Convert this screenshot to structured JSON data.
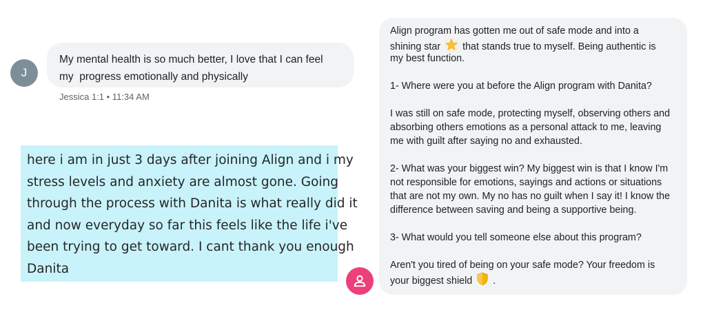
{
  "jessica": {
    "avatar_initial": "J",
    "message_lines": [
      "My mental health is so much better, I love that I can feel",
      "my  progress emotionally and physically"
    ],
    "meta": "Jessica 1:1 • 11:34 AM"
  },
  "note": {
    "lines": [
      "here i am in just 3 days after joining Align and i my",
      "stress levels and anxiety are almost gone. Going",
      "through the process with Danita is what really did it",
      "and now everyday  so far this feels like the life i've",
      "been trying to get toward. I cant thank you enough",
      "Danita"
    ]
  },
  "align_message": {
    "line1": "Align program has gotten me out of safe mode and into a",
    "line2_before": "shining star",
    "line2_after": "that stands true to myself. Being authentic is",
    "line3": "my best function.",
    "q1": "1- Where were you at before the Align program with Danita?",
    "a1_lines": [
      "I was still on safe mode, protecting myself, observing others and",
      "absorbing others emotions as a personal attack to me, leaving",
      "me with guilt after saying no and exhausted."
    ],
    "q2_lines": [
      "2- What was your biggest win?  My biggest win is that I know I'm",
      "not responsible for emotions, sayings and actions or situations",
      "that are not my own. My no has no guilt when I say it! I know the",
      "difference between saving and being a supportive being."
    ],
    "q3": "3- What would you tell someone else about this program?",
    "a3_line1": "Aren't you tired of being on your safe mode? Your freedom is",
    "a3_before": "your biggest shield",
    "a3_after": ".",
    "star_emoji": "star-icon",
    "shield_emoji": "shield-icon"
  },
  "colors": {
    "bubble": "#f1f3f4",
    "note_bg": "#c8f3fb",
    "avatar_gray": "#7d8e99",
    "avatar_pink": "#ec407a"
  }
}
